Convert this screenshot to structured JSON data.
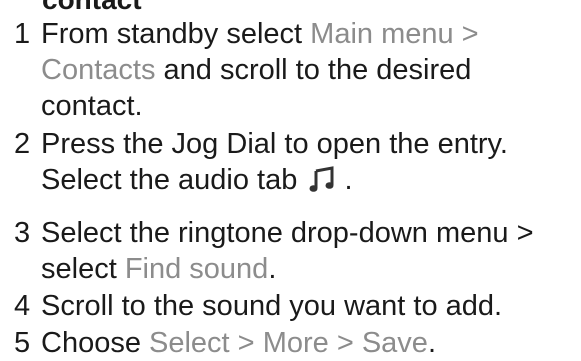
{
  "heading_fragment": "contact",
  "steps": [
    {
      "number": "1",
      "lines": [
        {
          "a": "From standby select ",
          "h1": "Main menu",
          "b": " >"
        },
        {
          "h1": "Contacts",
          "a": " and scroll to the desired"
        },
        {
          "a": "contact."
        }
      ]
    },
    {
      "number": "2",
      "lines": [
        {
          "a": "Press the Jog Dial to open the entry."
        },
        {
          "a": "Select the audio tab ",
          "icon": "music-note-icon",
          "b": " ."
        }
      ]
    },
    {
      "number": "3",
      "lines": [
        {
          "a": "Select the ringtone drop-down menu >"
        },
        {
          "a": "select ",
          "h1": "Find sound",
          "b": "."
        }
      ]
    },
    {
      "number": "4",
      "lines": [
        {
          "a": "Scroll to the sound you want to add."
        }
      ]
    },
    {
      "number": "5",
      "lines": [
        {
          "a": "Choose ",
          "h1": "Select",
          "b": " > ",
          "h2": "More",
          "c": " > ",
          "h3": "Save",
          "d": "."
        }
      ]
    }
  ],
  "colors": {
    "text": "#1a1a1a",
    "menu_highlight": "#8c8c8c"
  }
}
